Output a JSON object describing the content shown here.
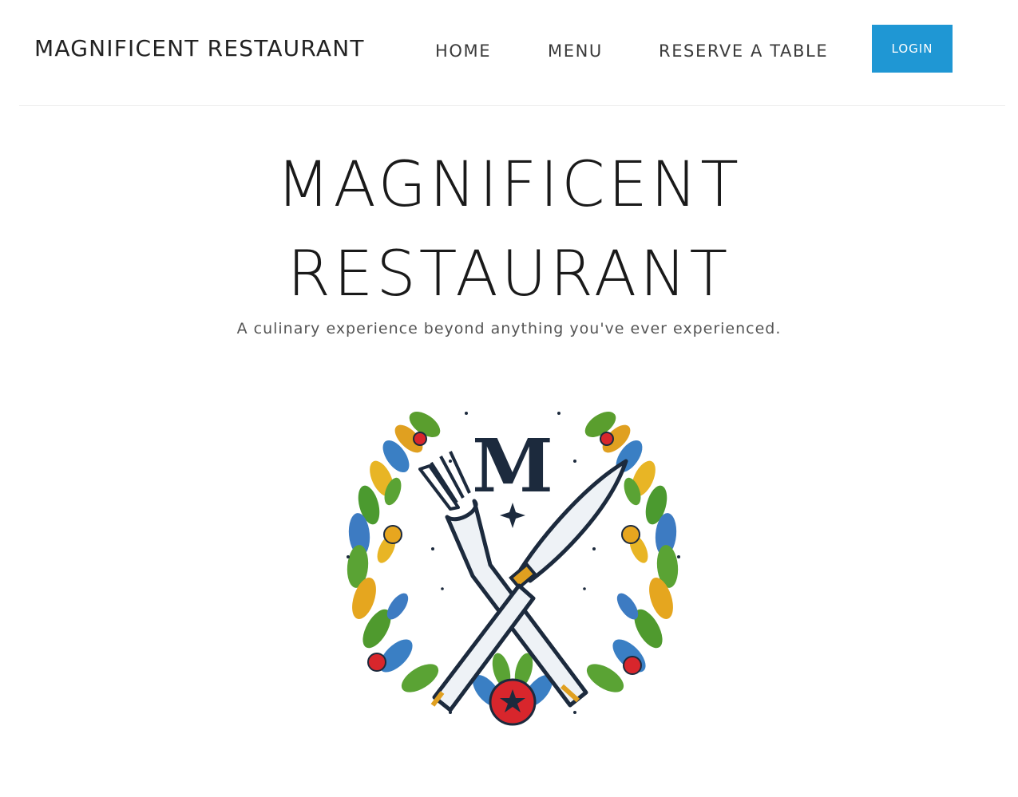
{
  "nav": {
    "brand": "MAGNIFICENT RESTAURANT",
    "links": [
      "HOME",
      "MENU",
      "RESERVE A TABLE"
    ],
    "login_label": "LOGIN"
  },
  "hero": {
    "title_line1": "MAGNIFICENT",
    "title_line2": "RESTAURANT",
    "tagline": "A culinary experience beyond anything you've ever experienced."
  },
  "logo": {
    "monogram": "M",
    "icon": "fork-knife-wreath-emblem"
  },
  "colors": {
    "accent": "#1f97d4",
    "text": "#1f1f1f",
    "muted": "#555555",
    "navy": "#1c2a3d"
  }
}
